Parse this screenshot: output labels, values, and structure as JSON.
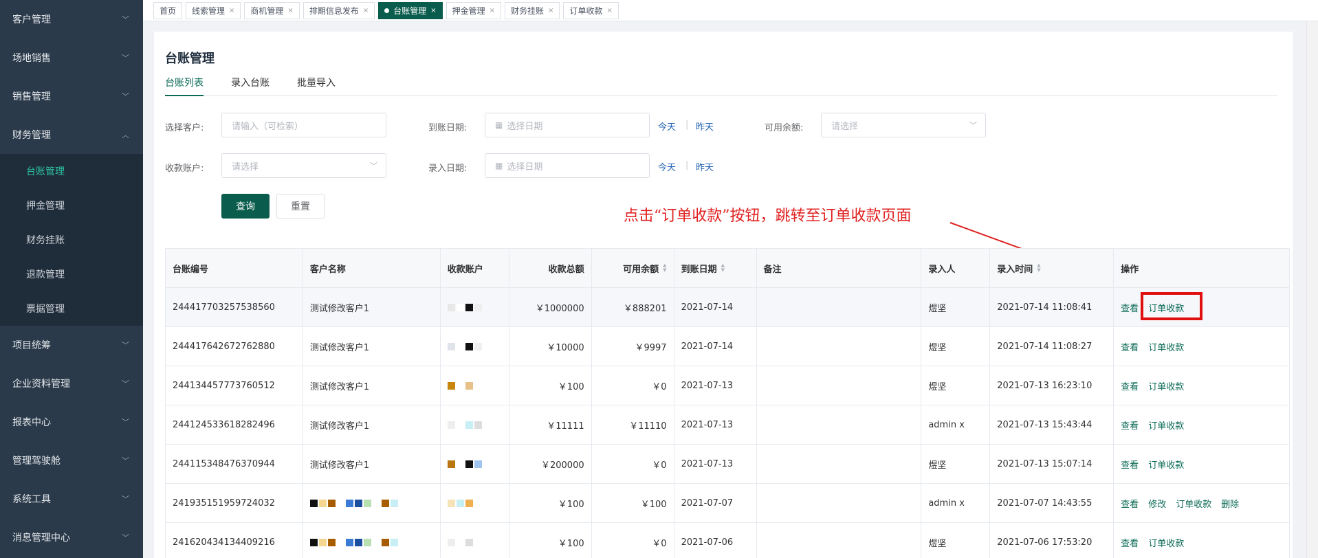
{
  "sidebar": {
    "items": [
      {
        "label": "客户管理"
      },
      {
        "label": "场地销售"
      },
      {
        "label": "销售管理"
      },
      {
        "label": "财务管理"
      },
      {
        "label": "项目统筹"
      },
      {
        "label": "企业资料管理"
      },
      {
        "label": "报表中心"
      },
      {
        "label": "管理驾驶舱"
      },
      {
        "label": "系统工具"
      },
      {
        "label": "消息管理中心"
      }
    ],
    "finance_sub": [
      {
        "label": "台账管理"
      },
      {
        "label": "押金管理"
      },
      {
        "label": "财务挂账"
      },
      {
        "label": "退款管理"
      },
      {
        "label": "票据管理"
      }
    ]
  },
  "tabs": [
    {
      "label": "首页"
    },
    {
      "label": "线索管理"
    },
    {
      "label": "商机管理"
    },
    {
      "label": "排期信息发布"
    },
    {
      "label": "台账管理"
    },
    {
      "label": "押金管理"
    },
    {
      "label": "财务挂账"
    },
    {
      "label": "订单收款"
    }
  ],
  "page": {
    "title": "台账管理",
    "subtabs": [
      "台账列表",
      "录入台账",
      "批量导入"
    ]
  },
  "filters": {
    "customer_label": "选择客户:",
    "customer_placeholder": "请输入（可检索）",
    "arrival_label": "到账日期:",
    "arrival_placeholder": "选择日期",
    "balance_label": "可用余额:",
    "balance_placeholder": "请选择",
    "account_label": "收款账户:",
    "account_placeholder": "请选择",
    "entry_label": "录入日期:",
    "entry_placeholder": "选择日期",
    "today": "今天",
    "yesterday": "昨天",
    "sep": "|",
    "query": "查询",
    "reset": "重置"
  },
  "annotation": "点击“订单收款”按钮，跳转至订单收款页面",
  "table": {
    "headers": [
      "台账编号",
      "客户名称",
      "收款账户",
      "收款总额",
      "可用余额",
      "到账日期",
      "备注",
      "录入人",
      "录入时间",
      "操作"
    ],
    "rows": [
      {
        "id": "244417703257538560",
        "customer": "测试修改客户1",
        "total": "￥1000000",
        "balance": "￥888201",
        "date": "2021-07-14",
        "note": "",
        "user": "煜坚",
        "time": "2021-07-14 11:08:41",
        "ops": [
          "查看",
          "订单收款"
        ]
      },
      {
        "id": "244417642672762880",
        "customer": "测试修改客户1",
        "total": "￥10000",
        "balance": "￥9997",
        "date": "2021-07-14",
        "note": "",
        "user": "煜坚",
        "time": "2021-07-14 11:08:27",
        "ops": [
          "查看",
          "订单收款"
        ]
      },
      {
        "id": "244134457773760512",
        "customer": "测试修改客户1",
        "total": "￥100",
        "balance": "￥0",
        "date": "2021-07-13",
        "note": "",
        "user": "煜坚",
        "time": "2021-07-13 16:23:10",
        "ops": [
          "查看",
          "订单收款"
        ]
      },
      {
        "id": "244124533618282496",
        "customer": "测试修改客户1",
        "total": "￥11111",
        "balance": "￥11110",
        "date": "2021-07-13",
        "note": "",
        "user": "admin x",
        "time": "2021-07-13 15:43:44",
        "ops": [
          "查看",
          "订单收款"
        ]
      },
      {
        "id": "244115348476370944",
        "customer": "测试修改客户1",
        "total": "￥200000",
        "balance": "￥0",
        "date": "2021-07-13",
        "note": "",
        "user": "煜坚",
        "time": "2021-07-13 15:07:14",
        "ops": [
          "查看",
          "订单收款"
        ]
      },
      {
        "id": "241935151959724032",
        "customer": "",
        "total": "￥100",
        "balance": "￥100",
        "date": "2021-07-07",
        "note": "",
        "user": "admin x",
        "time": "2021-07-07 14:43:55",
        "ops": [
          "查看",
          "修改",
          "订单收款",
          "删除"
        ]
      },
      {
        "id": "241620434134409216",
        "customer": "",
        "total": "￥100",
        "balance": "￥0",
        "date": "2021-07-06",
        "note": "",
        "user": "煜坚",
        "time": "2021-07-06 17:53:20",
        "ops": [
          "查看",
          "订单收款"
        ]
      }
    ]
  },
  "colors": {
    "primary": "#0a5c4c",
    "sidebar_bg": "#2b3a4a",
    "annotation": "#e02020"
  }
}
